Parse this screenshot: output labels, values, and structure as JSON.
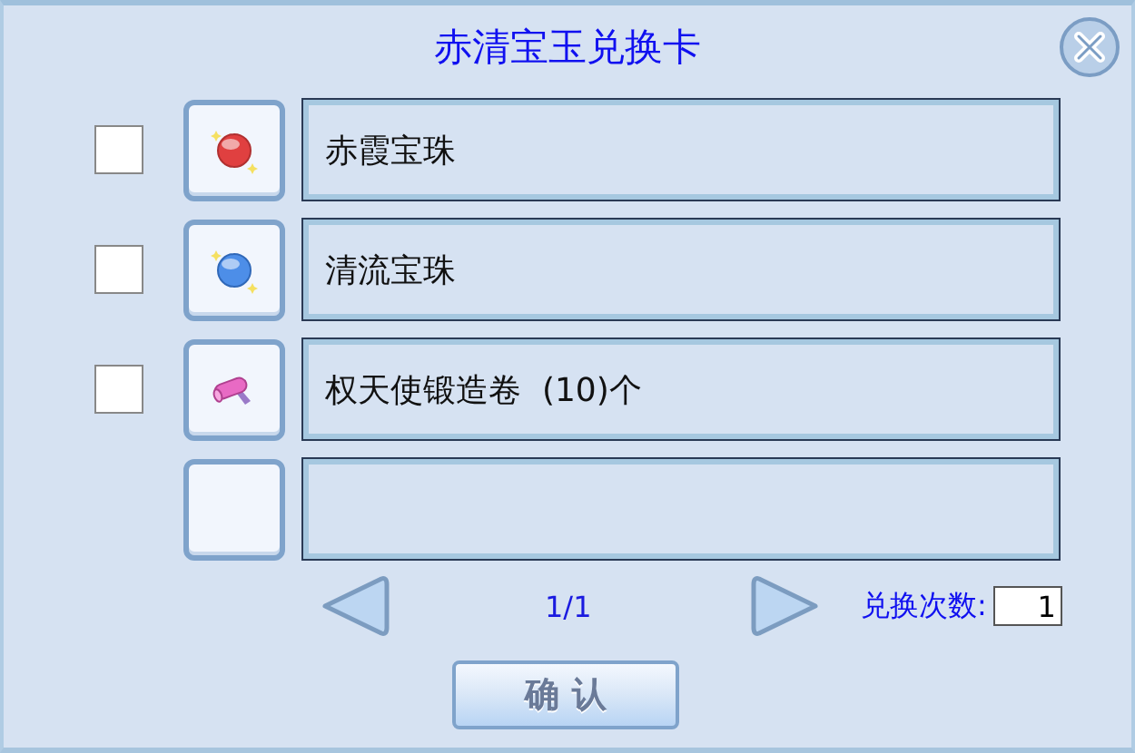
{
  "window": {
    "title": "赤清宝玉兑换卡"
  },
  "items": [
    {
      "kind": "red-orb",
      "label": "赤霞宝珠",
      "checked": false
    },
    {
      "kind": "blue-orb",
      "label": "清流宝珠",
      "checked": false
    },
    {
      "kind": "scroll",
      "label": "权天使锻造卷  (10)个",
      "checked": false
    },
    {
      "kind": "empty"
    }
  ],
  "pager": {
    "page": "1/1"
  },
  "count": {
    "label": "兑换次数:",
    "value": "1"
  },
  "confirm": "确 认"
}
